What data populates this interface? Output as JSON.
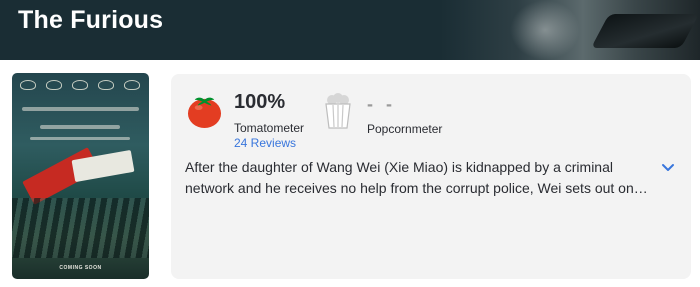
{
  "header": {
    "title": "The Furious"
  },
  "poster": {
    "bottom_text": "COMING SOON"
  },
  "scores": {
    "tomatometer": {
      "value": "100%",
      "label": "Tomatometer",
      "reviews_link": "24 Reviews",
      "icon": "fresh-tomato-icon"
    },
    "popcornmeter": {
      "value": "- -",
      "label": "Popcornmeter",
      "icon": "empty-popcorn-icon"
    }
  },
  "synopsis": {
    "text": "After the daughter of Wang Wei (Xie Miao) is kidnapped by a criminal network and he receives no help from the corrupt police, Wei sets out on…",
    "expand_icon": "chevron-down-icon"
  },
  "colors": {
    "header_bg": "#1a2d34",
    "card_bg": "#f3f3f3",
    "link": "#3976dc",
    "tomato_red": "#e33d22"
  }
}
